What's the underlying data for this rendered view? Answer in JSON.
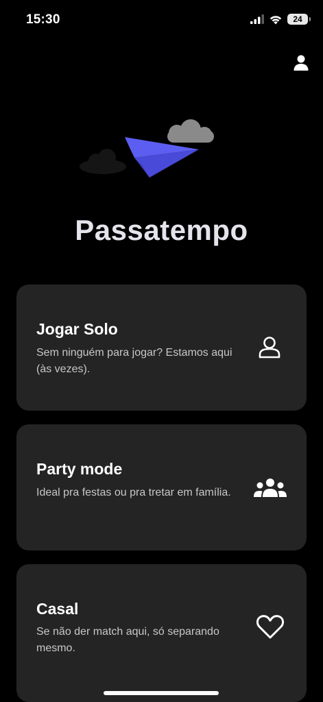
{
  "status_bar": {
    "time": "15:30",
    "battery_level": "24"
  },
  "app": {
    "title": "Passatempo"
  },
  "modes": [
    {
      "title": "Jogar Solo",
      "description": "Sem ninguém para jogar? Estamos aqui (às vezes).",
      "icon": "person-icon"
    },
    {
      "title": "Party mode",
      "description": "Ideal pra festas ou pra tretar em família.",
      "icon": "group-icon"
    },
    {
      "title": "Casal",
      "description": "Se não der match aqui, só separando mesmo.",
      "icon": "heart-icon"
    }
  ],
  "colors": {
    "background": "#000000",
    "card": "#242424",
    "plane": "#5b5ef0",
    "cloud": "#8a8a8a"
  }
}
